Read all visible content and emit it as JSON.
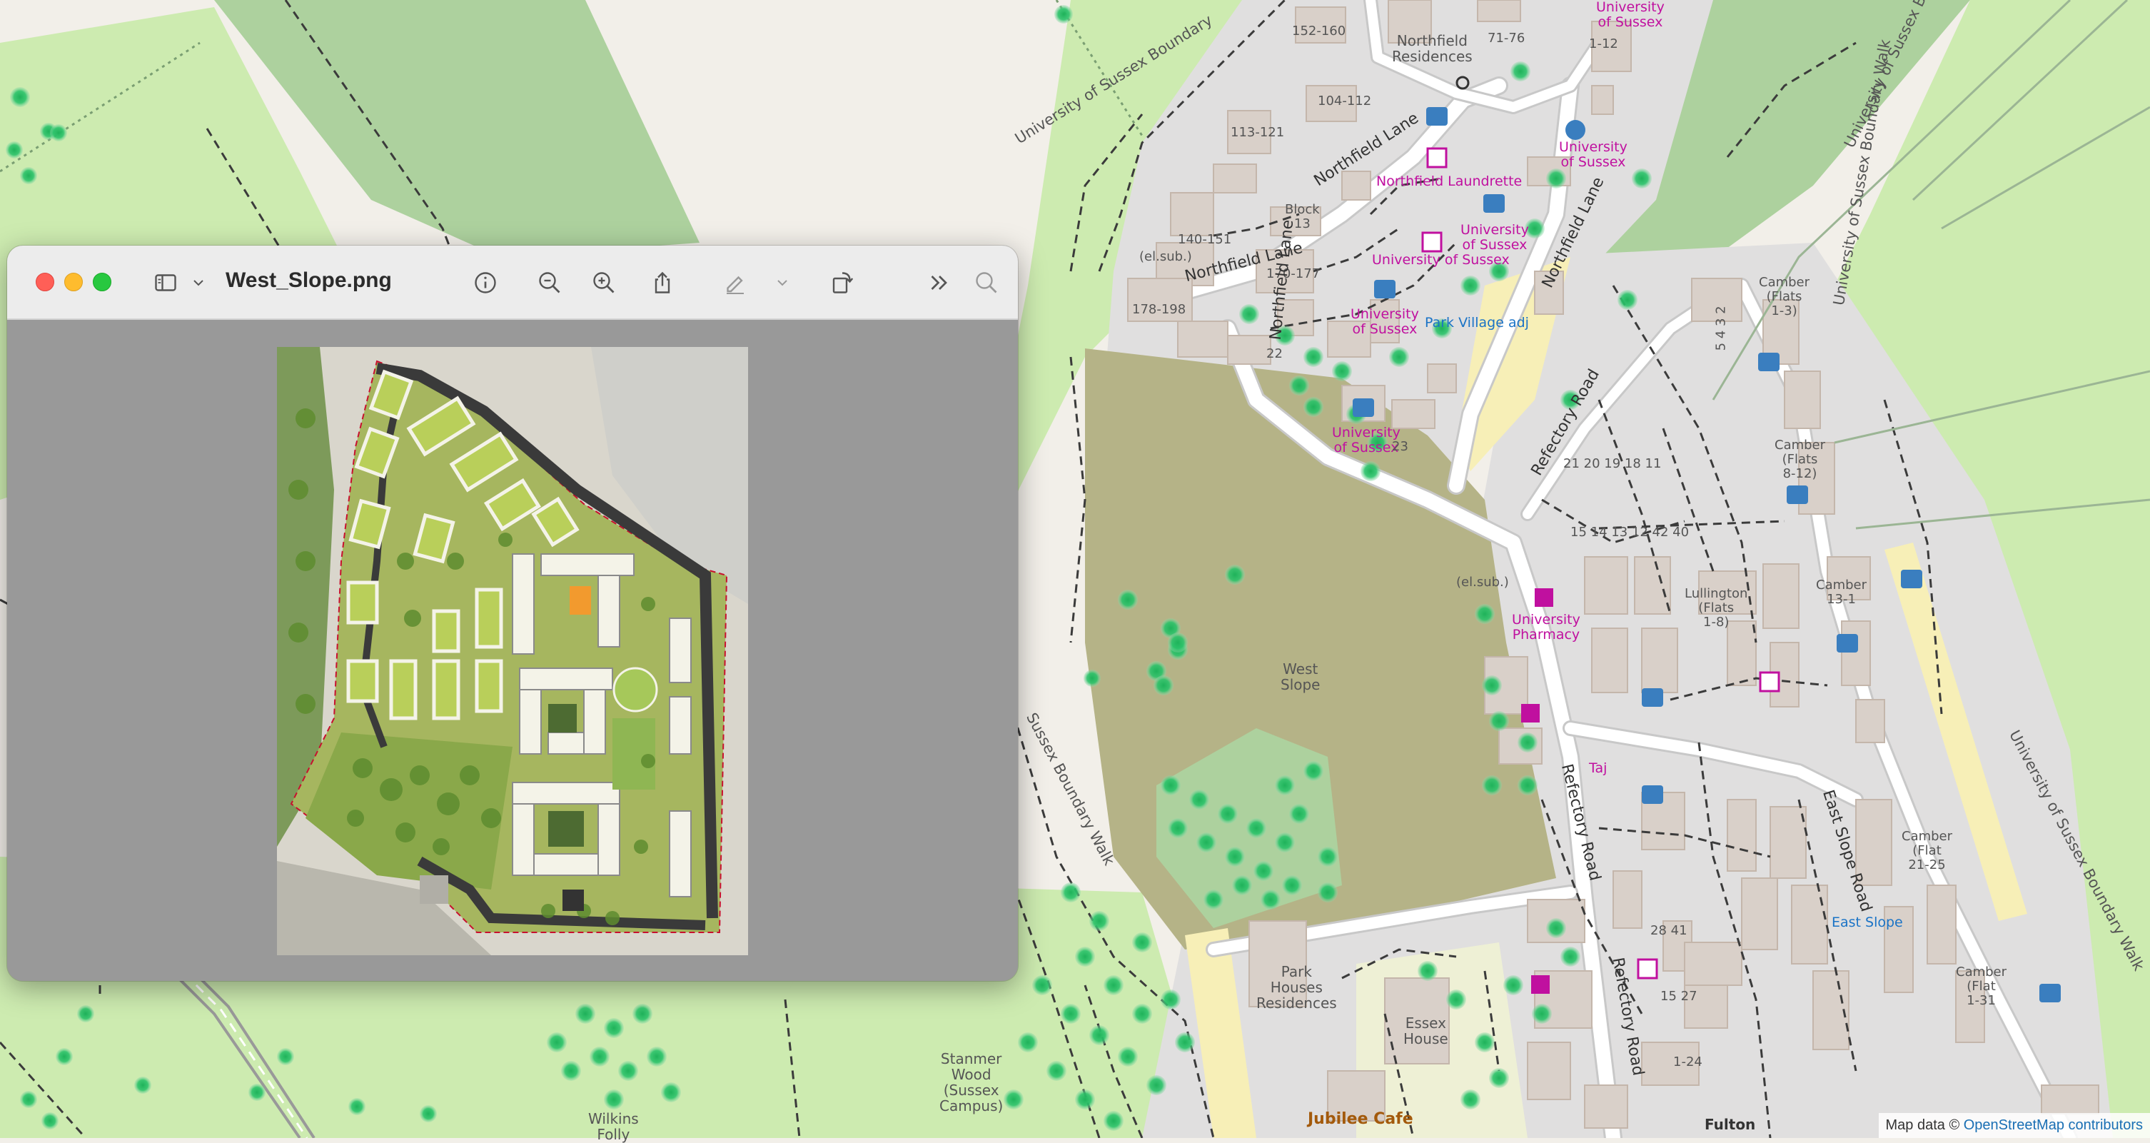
{
  "window": {
    "title": "West_Slope.png",
    "icons": [
      "sidebar-icon",
      "chevron-down-icon",
      "info-icon",
      "zoom-out-icon",
      "zoom-in-icon",
      "share-icon",
      "markup-icon",
      "chevron-down-icon",
      "rotate-icon",
      "more-icon",
      "search-icon"
    ]
  },
  "map": {
    "labels": {
      "northfield_residences": "Northfield\nResidences",
      "n152": "152-160",
      "n7176": "71-76",
      "n112": "1-12",
      "n104": "104-112",
      "n113": "113-121",
      "n140": "140-151",
      "n170": "170-177",
      "n178": "178-198",
      "block13": "Block\n13",
      "elsub1": "(el.sub.)",
      "elsub2": "(el.sub.)",
      "uni1": "University\nof Sussex",
      "uni2": "University\nof Sussex",
      "uni3": "University\nof Sussex",
      "uni4": "University of Sussex",
      "uni5": "University\nof Sussex",
      "uni6": "University\nof Sussex",
      "laundrette": "Northfield Laundrette",
      "park_village": "Park Village adj",
      "northfield_lane1": "Northfield Lane",
      "northfield_lane2": "Northfield Lane",
      "northfield_lane3": "Northfield Lane",
      "northfield_lane4": "Northfield Lane",
      "refectory1": "Refectory Road",
      "refectory2": "Refectory Road",
      "refectory3": "Refectory Road",
      "east_slope_road": "East Slope Road",
      "uni_boundary1": "University of Sussex Boundary",
      "uni_boundary2": "University of Sussex Boundary Walk",
      "uni_boundary3": "University of Sussex Boundary",
      "uni_boundary4": "University of Sussex Boundary Walk",
      "sussex_boundary": "Sussex Boundary Walk",
      "west_slope": "West\nSlope",
      "pharmacy": "University\nPharmacy",
      "taj": "Taj",
      "camber1": "Camber\n(Flats\n1-3)",
      "camber2": "Camber\n(Flats\n8-12)",
      "camber3": "Camber\n13-1",
      "camber4": "Camber\n(Flat\n21-25",
      "camber5": "Camber\n(Flat\n1-31",
      "lullington": "Lullington\n(Flats\n1-8)",
      "east_slope": "East Slope",
      "park_houses": "Park\nHouses\nResidences",
      "essex_house": "Essex\nHouse",
      "stanmer_wood": "Stanmer\nWood\n(Sussex\nCampus)",
      "wilkins": "Wilkins\nFolly",
      "jubilee": "Jubilee Cafe",
      "fulton": "Fulton",
      "n2841": "28 41",
      "n1527": "15 27",
      "n124": "1-24",
      "n22": "22",
      "n23": "23",
      "nums1": "5 4 3 2",
      "nums2": "15 14 13 12 42 40",
      "nums3": "21 20 19 18 11"
    },
    "attribution_prefix": "Map data © ",
    "attribution_link": "OpenStreetMap contributors"
  }
}
